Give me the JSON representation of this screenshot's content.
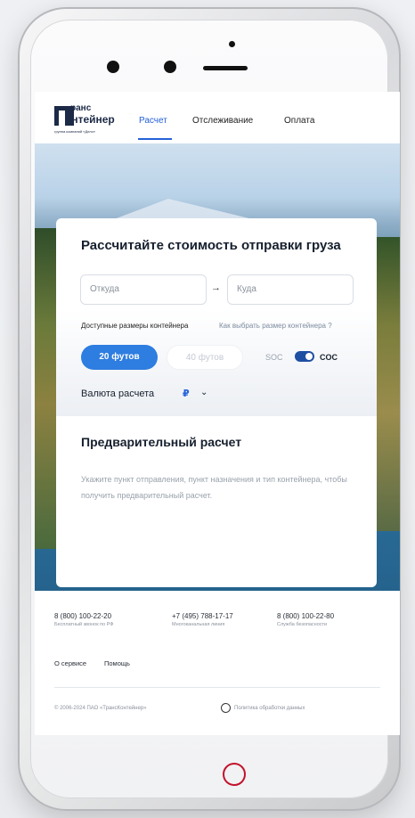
{
  "brand": {
    "line1": "ранс",
    "line2": "онтейнер",
    "sub": "группа компаний «Дело»"
  },
  "nav": {
    "items": [
      "Расчет",
      "Отслеживание",
      "Оплата"
    ]
  },
  "calculator": {
    "title": "Рассчитайте стоимость отправки груза",
    "from_placeholder": "Откуда",
    "to_placeholder": "Куда",
    "arrow": "→",
    "sizes_label": "Доступные размеры контейнера",
    "sizes_link": "Как выбрать размер контейнера ?",
    "size_options": [
      "20 футов",
      "40 футов"
    ],
    "selected_size": "20 футов",
    "soc_label": "SOC",
    "coc_label": "COC",
    "coc_enabled": true,
    "currency_label": "Валюта расчета",
    "currency_value": "₽"
  },
  "preliminary": {
    "title": "Предварительный расчет",
    "text": "Укажите пункт отправления, пункт назначения и тип контейнера, чтобы получить предварительный расчет."
  },
  "footer": {
    "phones": [
      {
        "number": "8 (800) 100-22-20",
        "desc": "Бесплатный звонок по РФ"
      },
      {
        "number": "+7 (495) 788-17-17",
        "desc": "Многоканальная линия"
      },
      {
        "number": "8 (800) 100-22-80",
        "desc": "Служба безопасности"
      }
    ],
    "links": [
      "О сервисе",
      "Помощь"
    ],
    "copyright": "© 2006-2024 ПАО «ТрансКонтейнер»",
    "policy": "Политика обработки данных"
  },
  "colors": {
    "accent": "#2561d9",
    "button": "#2e7de0",
    "home_button": "#c2132c"
  }
}
